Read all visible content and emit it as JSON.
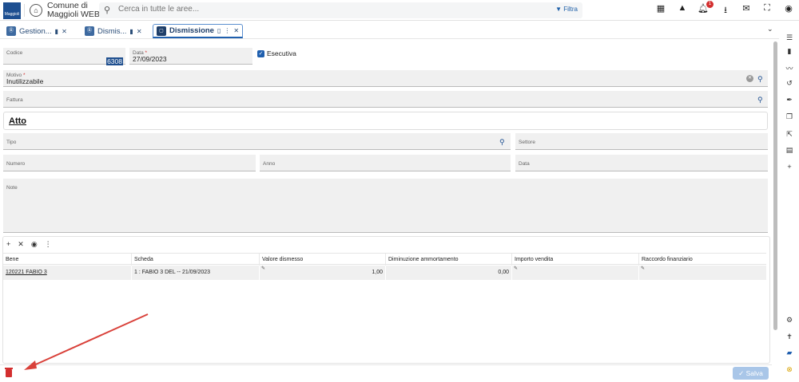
{
  "header": {
    "logo_text": "Maggioli",
    "app_name_line1": "Comune di",
    "app_name_line2": "Maggioli WEB",
    "search_placeholder": "Cerca in tutte le aree...",
    "filter_label": "Filtra",
    "notification_count": "1",
    "icons": [
      "grid-icon",
      "warning-icon",
      "bell-icon",
      "download-icon",
      "mail-icon",
      "fullscreen-icon",
      "user-icon"
    ]
  },
  "tabs": [
    {
      "label": "Gestion...",
      "active": false
    },
    {
      "label": "Dismis...",
      "active": false
    },
    {
      "label": "Dismissione",
      "active": true
    }
  ],
  "form": {
    "codice_label": "Codice",
    "codice_value": "6308",
    "data_label": "Data",
    "data_value": "27/09/2023",
    "esecutiva_label": "Esecutiva",
    "esecutiva_checked": true,
    "motivo_label": "Motivo",
    "motivo_value": "Inutilizzabile",
    "fattura_label": "Fattura",
    "section_title": "Atto",
    "tipo_label": "Tipo",
    "settore_label": "Settore",
    "numero_label": "Numero",
    "anno_label": "Anno",
    "data2_label": "Data",
    "note_label": "Note"
  },
  "grid": {
    "columns": [
      "Bene",
      "Scheda",
      "Valore dismesso",
      "Diminuzione ammortamento",
      "Importo vendita",
      "Raccordo finanziario"
    ],
    "rows": [
      {
        "bene": "120221 FABIO 3",
        "scheda": "1 : FABIO 3 DEL -- 21/09/2023",
        "valore": "1,00",
        "diminuzione": "0,00",
        "importo": "",
        "raccordo": ""
      }
    ]
  },
  "footer": {
    "save_label": "Salva"
  },
  "colors": {
    "brand": "#1d4f91",
    "accent": "#1f5fae",
    "danger": "#d32f2f",
    "annotation_arrow": "#d9413a"
  }
}
